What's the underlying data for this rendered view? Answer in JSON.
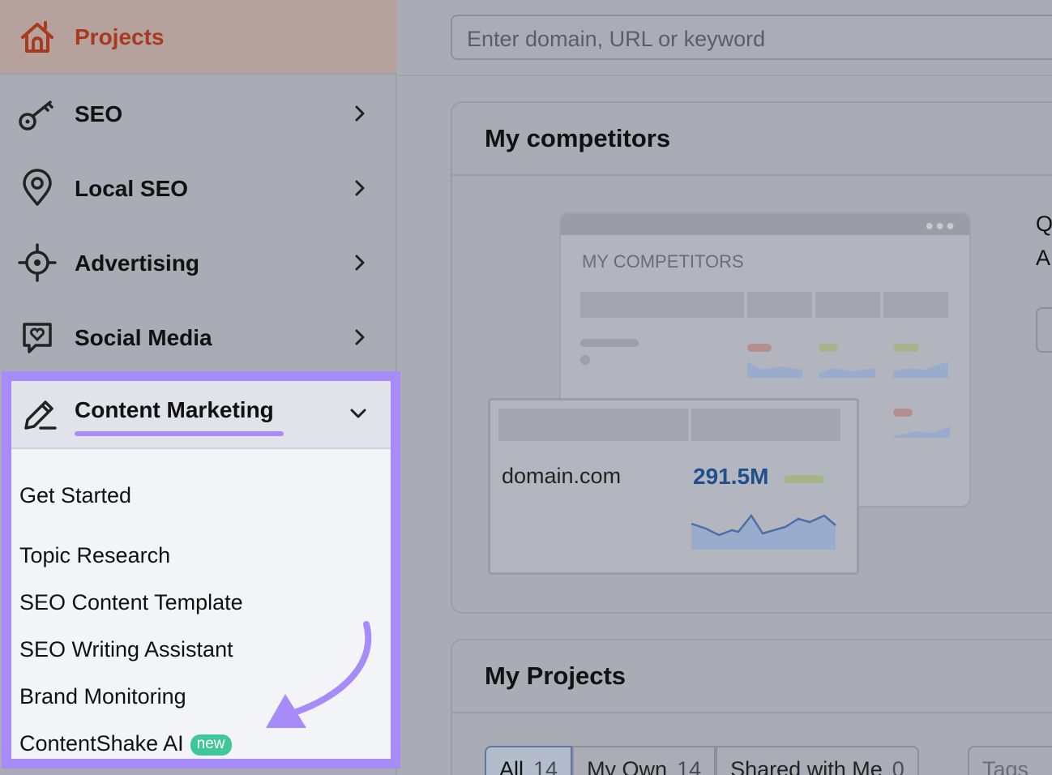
{
  "sidebar": {
    "projects_label": "Projects",
    "items": [
      {
        "label": "SEO",
        "icon": "seo-key-icon"
      },
      {
        "label": "Local SEO",
        "icon": "location-pin-icon"
      },
      {
        "label": "Advertising",
        "icon": "target-icon"
      },
      {
        "label": "Social Media",
        "icon": "chat-heart-icon"
      }
    ],
    "content_marketing": {
      "label": "Content Marketing",
      "icon": "pencil-icon",
      "subitems": [
        "Get Started",
        "Topic Research",
        "SEO Content Template",
        "SEO Writing Assistant",
        "Brand Monitoring",
        "ContentShake AI"
      ],
      "new_badge": "new"
    }
  },
  "search": {
    "placeholder": "Enter domain, URL or keyword"
  },
  "competitors_card": {
    "title": "My competitors",
    "illustration_caption": "MY COMPETITORS",
    "example_domain": "domain.com",
    "example_metric": "291.5M",
    "side_text_fragments": [
      "Q",
      "A"
    ]
  },
  "projects_card": {
    "title": "My Projects",
    "tabs": [
      {
        "label": "All",
        "count": "14"
      },
      {
        "label": "My Own",
        "count": "14"
      },
      {
        "label": "Shared with Me",
        "count": "0"
      }
    ],
    "tags_label": "Tags"
  },
  "colors": {
    "highlight": "#a78bf8",
    "projects_accent": "#a83a20",
    "metric_blue": "#1f4f8d",
    "badge_green": "#3fc79a"
  }
}
